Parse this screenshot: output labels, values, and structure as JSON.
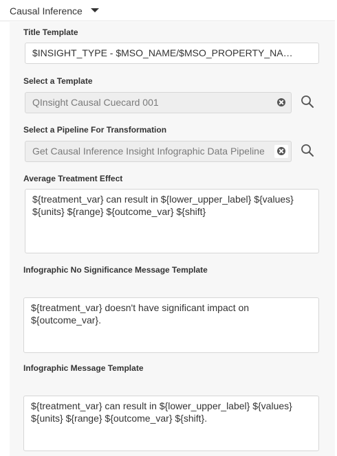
{
  "section": {
    "title": "Causal Inference"
  },
  "fields": {
    "title_template": {
      "label": "Title Template",
      "value": "$INSIGHT_TYPE - $MSO_NAME/$MSO_PROPERTY_NAME for $PERIOD"
    },
    "template": {
      "label": "Select a Template",
      "value": "QInsight Causal Cuecard 001"
    },
    "pipeline": {
      "label": "Select a Pipeline For Transformation",
      "value": "Get Causal Inference Insight Infographic Data Pipeline"
    },
    "ate": {
      "label": "Average Treatment Effect",
      "line1": "${treatment_var} can result in ${lower_upper_label} ${values}",
      "line2": "${units} ${range} ${outcome_var} ${shift}"
    },
    "no_sig": {
      "label": "Infographic No Significance Message Template",
      "line1": "${treatment_var} doesn't have significant impact on",
      "line2": "${outcome_var}."
    },
    "message": {
      "label": "Infographic Message Template",
      "line1": "${treatment_var} can result in ${lower_upper_label} ${values}",
      "line2": "${units} ${range} ${outcome_var} ${shift}."
    }
  }
}
